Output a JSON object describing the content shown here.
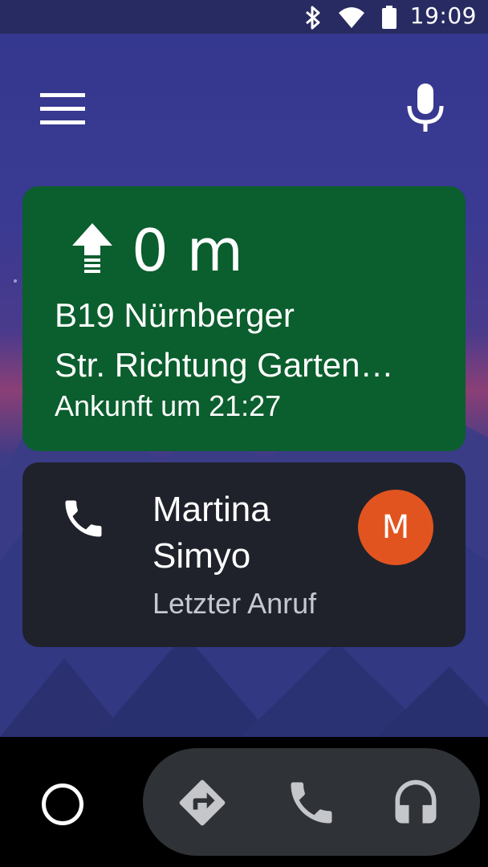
{
  "status_bar": {
    "time": "19:09",
    "icons": [
      "bluetooth-icon",
      "wifi-icon",
      "battery-icon"
    ]
  },
  "toolbar": {
    "menu_icon": "menu-icon",
    "mic_icon": "microphone-icon"
  },
  "navigation_card": {
    "maneuver_icon": "arrow-straight-icon",
    "distance": "0 m",
    "street_line1": "B19 Nürnberger",
    "street_line2": "Str. Richtung Garten…",
    "eta": "Ankunft um 21:27",
    "background_color": "#0b5e2d"
  },
  "call_card": {
    "icon": "phone-icon",
    "name_line1": "Martina",
    "name_line2": "Simyo",
    "subtitle": "Letzter Anruf",
    "avatar_letter": "M",
    "avatar_color": "#e2541f"
  },
  "bottom_bar": {
    "home_icon": "home-circle-icon",
    "apps": [
      "navigation-icon",
      "phone-icon",
      "headphones-icon"
    ]
  }
}
